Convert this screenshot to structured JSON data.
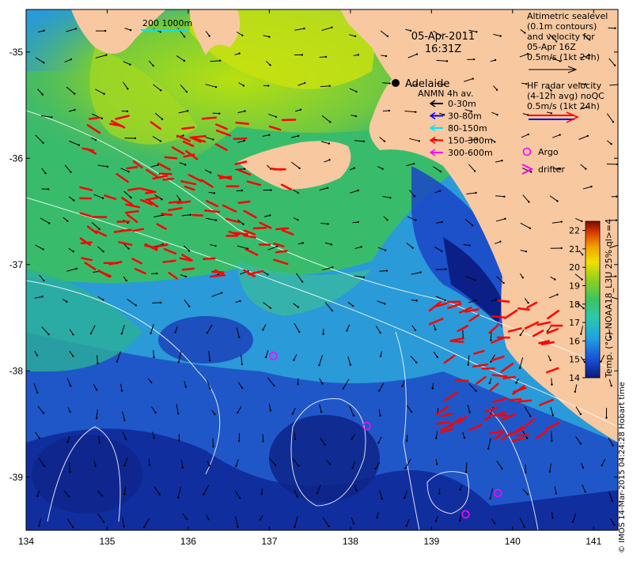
{
  "map": {
    "date": "05-Apr-2011",
    "time": "16:31Z",
    "city": "Adelaide",
    "scale_bar_label": "200  1000m",
    "lon_ticks": [
      "134",
      "135",
      "136",
      "137",
      "138",
      "139",
      "140",
      "141"
    ],
    "lat_ticks": [
      "-35",
      "-36",
      "-37",
      "-38",
      "-39"
    ],
    "lon_range": [
      134,
      141.3
    ],
    "lat_range": [
      -39.5,
      -34.6
    ]
  },
  "altimetry_note": [
    "Altimetric sealevel",
    "(0.1m contours)",
    "and velocity for",
    "05-Apr 16Z",
    "0.5m/s (1kt 24h)"
  ],
  "hf_radar_note": [
    "HF radar velocity",
    "(4-12h avg) noQC",
    "0.5m/s (1kt 24h)"
  ],
  "anmn_legend": {
    "title": "ANMN 4h av.",
    "items": [
      {
        "label": "0-30m",
        "color": "#000000"
      },
      {
        "label": "30-80m",
        "color": "#0000ff"
      },
      {
        "label": "80-150m",
        "color": "#00e5ff"
      },
      {
        "label": "150-300m",
        "color": "#ff0000"
      },
      {
        "label": "300-600m",
        "color": "#ff00ff"
      }
    ]
  },
  "markers_legend": {
    "argo": "Argo",
    "drifter": "drifter",
    "color": "#ff00ff"
  },
  "colorbar": {
    "title": "Temp. (°C) NOAA18_L3U 25% ql>=4",
    "ticks": [
      "22",
      "21",
      "20",
      "19",
      "18",
      "17",
      "16",
      "15",
      "14"
    ],
    "range": [
      14,
      22.5
    ]
  },
  "credit": "© IMOS 14-Mar-2015 04:24:28 Hobart time",
  "argo_floats": [
    {
      "lon": 137.05,
      "lat": -37.86
    },
    {
      "lon": 138.2,
      "lat": -38.52
    },
    {
      "lon": 139.82,
      "lat": -39.15
    },
    {
      "lon": 139.42,
      "lat": -39.35
    }
  ],
  "colors": {
    "land": "#f8c8a0",
    "ocean_cold": "#0a1a8c",
    "ocean_warm": "#a8d820",
    "contour": "#ffffff"
  }
}
